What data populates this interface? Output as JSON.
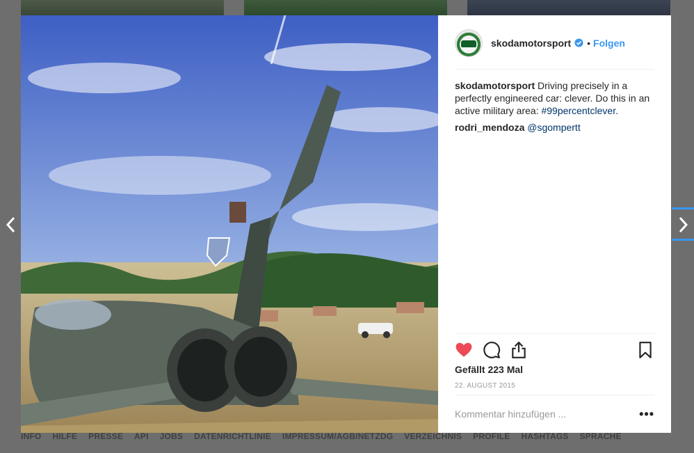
{
  "post": {
    "username": "skodamotorsport",
    "follow_label": "Folgen",
    "separator": "•",
    "caption_user": "skodamotorsport",
    "caption_text": "Driving precisely in a perfectly engineered car: clever. Do this in an active military area: ",
    "caption_hashtag": "#99percentclever",
    "caption_end": ".",
    "comment_user": "rodri_mendoza",
    "comment_mention": "@sgompertt",
    "likes": "Gefällt 223 Mal",
    "date": "22. AUGUST 2015",
    "comment_placeholder": "Kommentar hinzufügen ...",
    "more_label": "•••",
    "photo_icons": [
      "heart-icon",
      "comment-icon",
      "share-icon",
      "bookmark-icon"
    ]
  },
  "footer": {
    "links": [
      "INFO",
      "HILFE",
      "PRESSE",
      "API",
      "JOBS",
      "DATENRICHTLINIE",
      "IMPRESSUM/AGB/NETZDG",
      "VERZEICHNIS",
      "PROFILE",
      "HASHTAGS",
      "SPRACHE"
    ]
  },
  "colors": {
    "accent": "#3897f0",
    "like": "#ed4956",
    "text": "#262626",
    "muted": "#999999",
    "overlay": "#6e6e6e"
  }
}
